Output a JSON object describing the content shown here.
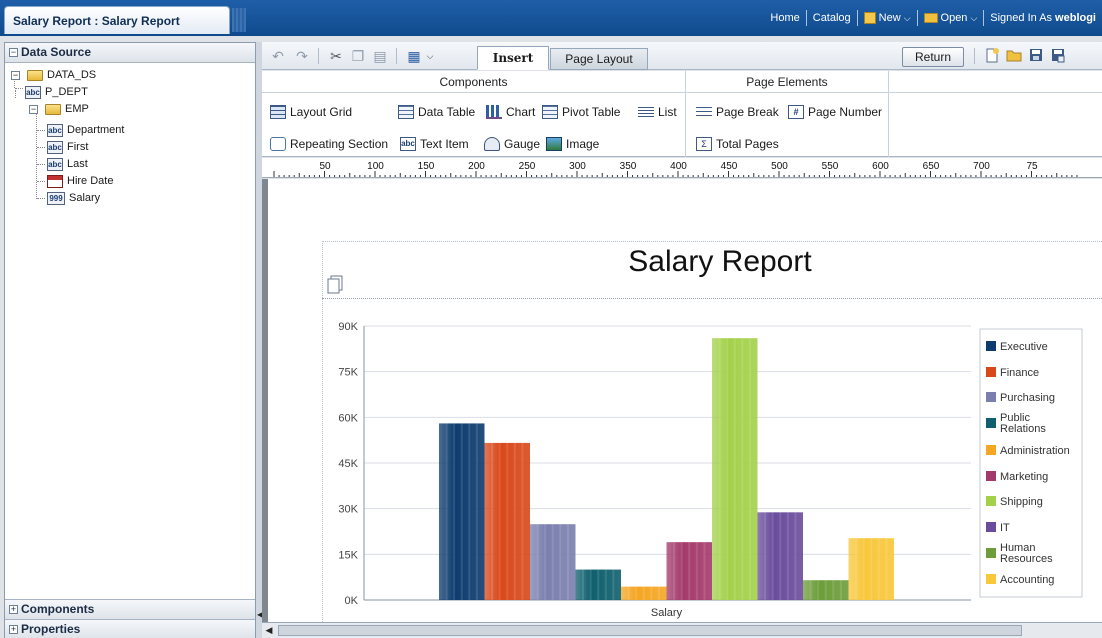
{
  "window": {
    "title": "Salary Report : Salary Report"
  },
  "topnav": {
    "home": "Home",
    "catalog": "Catalog",
    "new": "New",
    "open": "Open",
    "signed_in": "Signed In As",
    "user": "weblogi"
  },
  "datasource": {
    "header": "Data Source",
    "items": [
      {
        "label": "DATA_DS",
        "icon": "folder-icon"
      },
      {
        "label": "P_DEPT",
        "icon": "text-field-icon"
      },
      {
        "label": "EMP",
        "icon": "folder-icon"
      },
      {
        "label": "Department",
        "icon": "text-field-icon"
      },
      {
        "label": "First",
        "icon": "text-field-icon"
      },
      {
        "label": "Last",
        "icon": "text-field-icon"
      },
      {
        "label": "Hire Date",
        "icon": "date-field-icon"
      },
      {
        "label": "Salary",
        "icon": "number-field-icon"
      }
    ]
  },
  "panels": {
    "components": "Components",
    "properties": "Properties"
  },
  "toolbar": {
    "tab_insert": "Insert",
    "tab_page_layout": "Page Layout",
    "return": "Return"
  },
  "ribbon": {
    "components_title": "Components",
    "page_elements_title": "Page Elements",
    "layout_grid": "Layout Grid",
    "data_table": "Data Table",
    "chart": "Chart",
    "pivot_table": "Pivot Table",
    "list": "List",
    "repeating_section": "Repeating Section",
    "text_item": "Text Item",
    "gauge": "Gauge",
    "image": "Image",
    "page_break": "Page Break",
    "page_number": "Page Number",
    "total_pages": "Total Pages"
  },
  "ruler": {
    "ticks": [
      "50",
      "100",
      "150",
      "200",
      "250",
      "300",
      "350",
      "400",
      "450",
      "500",
      "550",
      "600",
      "650",
      "700",
      "75"
    ]
  },
  "report": {
    "title": "Salary Report"
  },
  "chart_data": {
    "type": "bar",
    "title": "Salary Report",
    "categories": [
      "Salary"
    ],
    "xlabel": "Salary",
    "ylabel": "",
    "ylim": [
      0,
      90000
    ],
    "yticks": [
      "0K",
      "15K",
      "30K",
      "45K",
      "60K",
      "75K",
      "90K"
    ],
    "legend_position": "right",
    "grid": true,
    "series": [
      {
        "name": "Executive",
        "values": [
          58000
        ],
        "color": "#0d3b6e"
      },
      {
        "name": "Finance",
        "values": [
          51600
        ],
        "color": "#d9481a"
      },
      {
        "name": "Purchasing",
        "values": [
          24900
        ],
        "color": "#7a7fae"
      },
      {
        "name": "Public Relations",
        "values": [
          10000
        ],
        "color": "#0f5f6e"
      },
      {
        "name": "Administration",
        "values": [
          4400
        ],
        "color": "#f5a623"
      },
      {
        "name": "Marketing",
        "values": [
          19000
        ],
        "color": "#a43a6b"
      },
      {
        "name": "Shipping",
        "values": [
          86000
        ],
        "color": "#a3d14a"
      },
      {
        "name": "IT",
        "values": [
          28800
        ],
        "color": "#6a4c9c"
      },
      {
        "name": "Human Resources",
        "values": [
          6500
        ],
        "color": "#6c9d3a"
      },
      {
        "name": "Accounting",
        "values": [
          20300
        ],
        "color": "#f8c73a"
      }
    ]
  }
}
